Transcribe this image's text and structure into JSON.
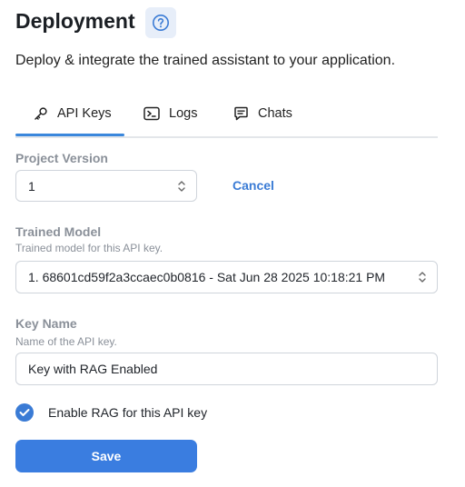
{
  "header": {
    "title": "Deployment",
    "help_icon": "question-circle-icon",
    "subtitle": "Deploy & integrate the trained assistant to your application."
  },
  "tabs": [
    {
      "label": "API Keys",
      "icon": "key-icon",
      "active": true
    },
    {
      "label": "Logs",
      "icon": "terminal-icon",
      "active": false
    },
    {
      "label": "Chats",
      "icon": "chat-icon",
      "active": false
    }
  ],
  "form": {
    "project_version": {
      "label": "Project Version",
      "value": "1",
      "cancel_label": "Cancel"
    },
    "trained_model": {
      "label": "Trained Model",
      "help": "Trained model for this API key.",
      "value": "1. 68601cd59f2a3ccaec0b0816 - Sat Jun 28 2025 10:18:21 PM"
    },
    "key_name": {
      "label": "Key Name",
      "help": "Name of the API key.",
      "value": "Key with RAG Enabled"
    },
    "rag": {
      "label": "Enable RAG for this API key",
      "checked": true
    },
    "save_label": "Save"
  },
  "colors": {
    "accent": "#3a7de0",
    "muted_label": "#8a9099",
    "border": "#cfd4db"
  }
}
